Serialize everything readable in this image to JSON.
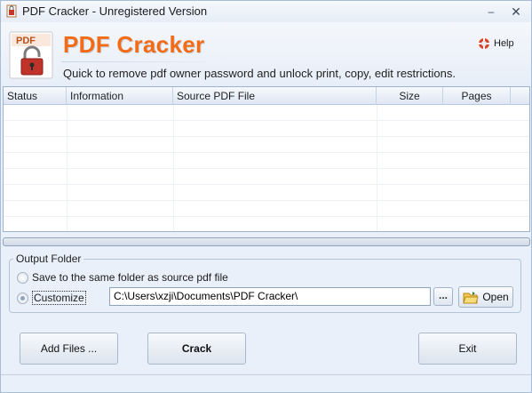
{
  "window": {
    "title": "PDF Cracker - Unregistered Version",
    "minimize_glyph": "–",
    "close_glyph": "✕"
  },
  "header": {
    "app_name": "PDF Cracker",
    "tagline": "Quick to remove pdf owner password and unlock print, copy, edit restrictions.",
    "help_label": "Help",
    "logo_text": "PDF",
    "icons": {
      "logo": "pdf-lock-icon",
      "help": "lifebuoy-icon"
    },
    "accent_color": "#f46b16"
  },
  "file_list": {
    "columns": [
      "Status",
      "Information",
      "Source PDF File",
      "Size",
      "Pages",
      ""
    ],
    "rows": []
  },
  "progress": {
    "value": 0
  },
  "output_folder": {
    "legend": "Output Folder",
    "options": [
      {
        "label": "Save to the same folder as source pdf file",
        "checked": false
      },
      {
        "label": "Customize",
        "checked": true
      }
    ],
    "path": "C:\\Users\\xzji\\Documents\\PDF Cracker\\",
    "browse_label": "...",
    "open_label": "Open"
  },
  "buttons": {
    "add_files": "Add Files ...",
    "crack": "Crack",
    "exit": "Exit"
  }
}
